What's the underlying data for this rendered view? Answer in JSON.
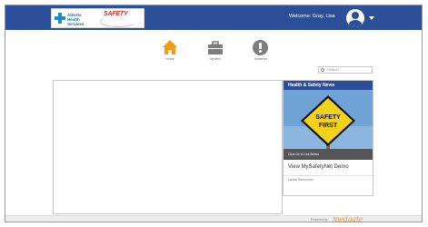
{
  "header": {
    "org_name_line1": "Alberta Health",
    "org_name_line2": "Services",
    "app_logo_text": "SAFETY",
    "welcome_text": "Welcome: Gray, Lisa",
    "bar_color": "#2c4f9a"
  },
  "nav": {
    "items": [
      {
        "label": "Home",
        "icon": "home-icon",
        "color": "#f39c12"
      },
      {
        "label": "MyItem",
        "icon": "toolbox-icon",
        "color": "#7d7d7d"
      },
      {
        "label": "Incidents",
        "icon": "alert-icon",
        "color": "#7d7d7d"
      }
    ]
  },
  "search": {
    "placeholder": "Search..."
  },
  "news": {
    "title": "Health & Safety News",
    "sign_text_line1": "SAFETY",
    "sign_text_line2": "FIRST",
    "caption": "Click On A Link Below",
    "link_text": "View MySafetyNet Demo",
    "sub_text": "Useful Resources"
  },
  "footer": {
    "powered_by": "Powered by",
    "brand": "medgate"
  }
}
